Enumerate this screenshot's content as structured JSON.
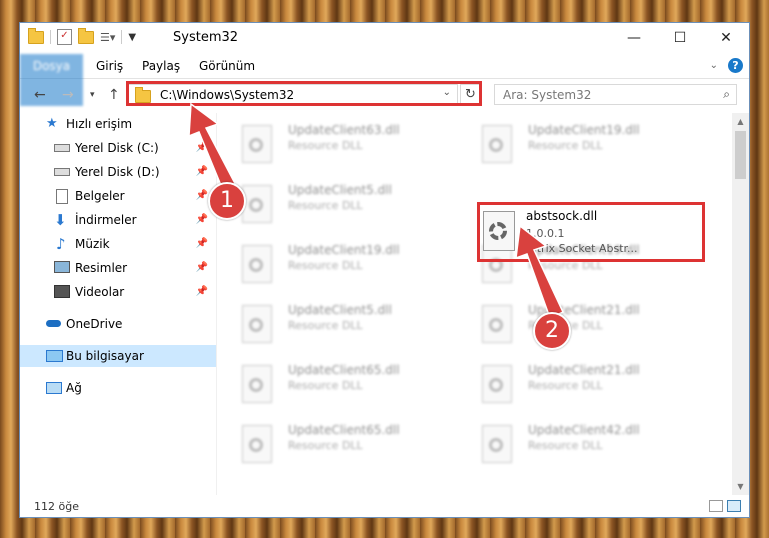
{
  "window": {
    "title": "System32",
    "controls": {
      "minimize": "—",
      "maximize": "☐",
      "close": "✕"
    }
  },
  "ribbon": {
    "tabs": [
      "Dosya",
      "Giriş",
      "Paylaş",
      "Görünüm"
    ],
    "help": "?"
  },
  "navigation": {
    "address": "C:\\Windows\\System32",
    "search_placeholder": "Ara: System32"
  },
  "sidebar": {
    "quick_access": "Hızlı erişim",
    "items": [
      {
        "label": "Yerel Disk (C:)",
        "icon": "drive-icon",
        "pinned": true
      },
      {
        "label": "Yerel Disk (D:)",
        "icon": "drive-icon",
        "pinned": true
      },
      {
        "label": "Belgeler",
        "icon": "documents-icon",
        "pinned": true
      },
      {
        "label": "İndirmeler",
        "icon": "download-icon",
        "pinned": true
      },
      {
        "label": "Müzik",
        "icon": "music-icon",
        "pinned": true
      },
      {
        "label": "Resimler",
        "icon": "pictures-icon",
        "pinned": true
      },
      {
        "label": "Videolar",
        "icon": "videos-icon",
        "pinned": true
      }
    ],
    "onedrive": "OneDrive",
    "this_pc": "Bu bilgisayar",
    "network": "Ağ"
  },
  "files": [
    {
      "name": "UpdateClient63.dll",
      "desc": "Resource DLL"
    },
    {
      "name": "UpdateClient19.dll",
      "desc": "Resource DLL"
    },
    {
      "name": "UpdateClient5.dll",
      "desc": "Resource DLL"
    },
    {
      "name": "UpdateClient19.dll",
      "desc": "Resource DLL"
    },
    {
      "name": "UpdateClient19.dll",
      "desc": "Resource DLL"
    },
    {
      "name": "UpdateClient5.dll",
      "desc": "Resource DLL"
    },
    {
      "name": "UpdateClient21.dll",
      "desc": "Resource DLL"
    },
    {
      "name": "UpdateClient65.dll",
      "desc": "Resource DLL"
    },
    {
      "name": "UpdateClient21.dll",
      "desc": "Resource DLL"
    },
    {
      "name": "UpdateClient65.dll",
      "desc": "Resource DLL"
    },
    {
      "name": "UpdateClient42.dll",
      "desc": "Resource DLL"
    }
  ],
  "target_file": {
    "name": "abstsock.dll",
    "version": "1.0.0.1",
    "desc": "Citrix Socket Abstr..."
  },
  "status": {
    "item_count": "112 öğe"
  },
  "annotations": {
    "step1": "1",
    "step2": "2",
    "color": "#d9413e"
  }
}
